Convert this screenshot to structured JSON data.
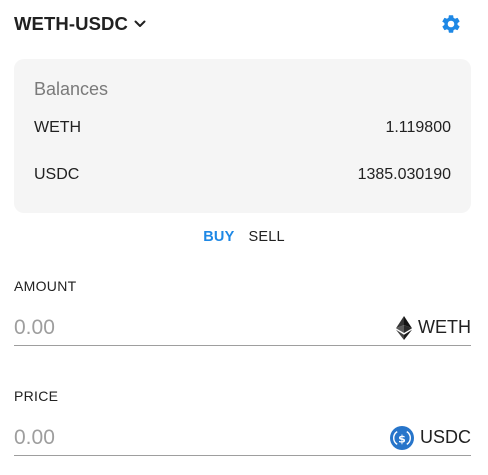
{
  "header": {
    "pair": "WETH-USDC",
    "settings_icon": "gear-icon",
    "accent_color": "#1e88e5"
  },
  "balances": {
    "title": "Balances",
    "rows": [
      {
        "token": "WETH",
        "amount": "1.119800"
      },
      {
        "token": "USDC",
        "amount": "1385.030190"
      }
    ]
  },
  "tabs": {
    "items": [
      "BUY",
      "SELL"
    ],
    "active": "BUY"
  },
  "amount": {
    "label": "AMOUNT",
    "placeholder": "0.00",
    "value": "",
    "token": "WETH",
    "token_icon": "ethereum-icon"
  },
  "price": {
    "label": "PRICE",
    "placeholder": "0.00",
    "value": "",
    "token": "USDC",
    "token_icon": "usdc-icon"
  }
}
